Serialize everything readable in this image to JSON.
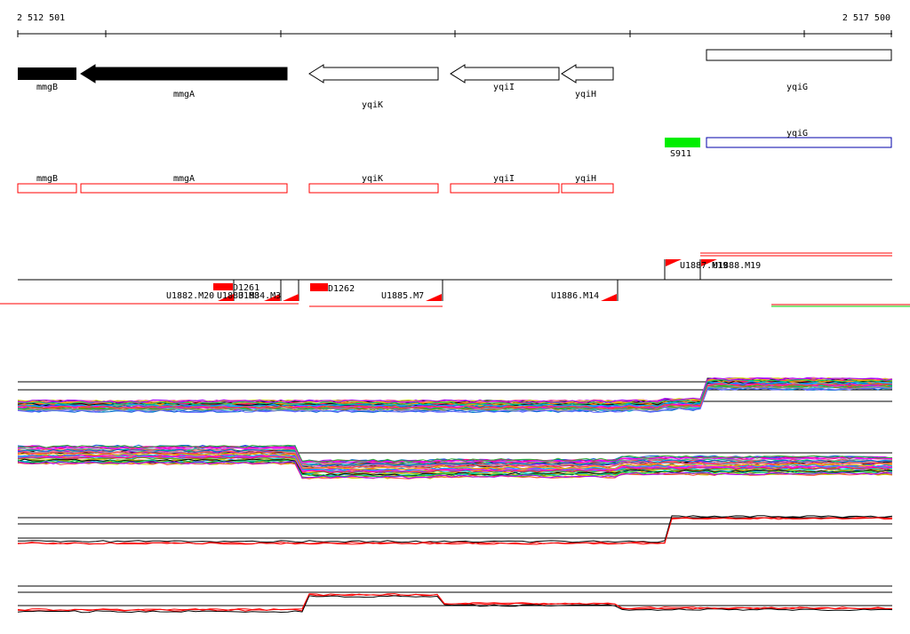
{
  "ruler": {
    "start_label": "2 512 501",
    "end_label": "2 517 500"
  },
  "genes_top": [
    {
      "label": "mmgB",
      "style": "filled",
      "strand": "plus"
    },
    {
      "label": "mmgA",
      "style": "filled",
      "strand": "minus"
    },
    {
      "label": "yqiK",
      "style": "outline",
      "strand": "minus"
    },
    {
      "label": "yqiI",
      "style": "outline",
      "strand": "minus"
    },
    {
      "label": "yqiH",
      "style": "outline",
      "strand": "minus"
    },
    {
      "label": "yqiG",
      "style": "outline",
      "strand": "none"
    }
  ],
  "track2": {
    "feature_label": "S911",
    "gene_label": "yqiG",
    "feature_color": "#00ee00",
    "gene_color": "#0000aa"
  },
  "genes_red": [
    {
      "label": "mmgB"
    },
    {
      "label": "mmgA"
    },
    {
      "label": "yqiK"
    },
    {
      "label": "yqiI"
    },
    {
      "label": "yqiH"
    }
  ],
  "transcripts": {
    "labels": [
      "U1882.M20",
      "U1883.M3",
      "U1884.M3",
      "U1885.M7",
      "U1886.M14",
      "U1887.M19",
      "U1888.M19"
    ],
    "tiles": [
      "D1261",
      "D1262"
    ],
    "color": "#ff0000"
  },
  "colors": {
    "red": "#ff0000",
    "green": "#00cc00",
    "black": "#000000"
  }
}
